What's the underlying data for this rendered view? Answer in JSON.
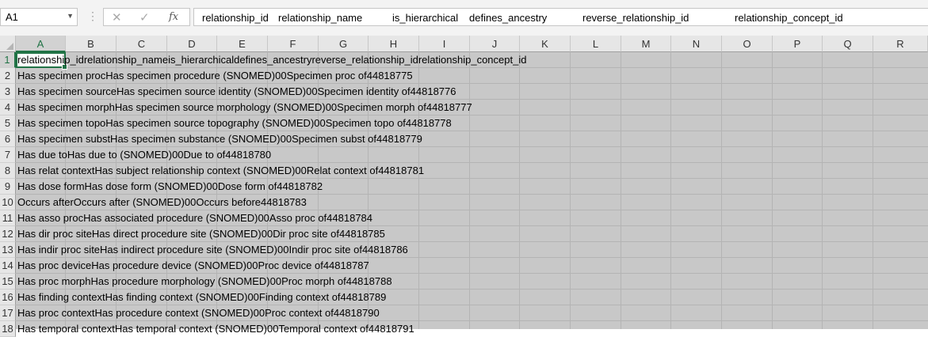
{
  "name_box": {
    "value": "A1",
    "arrow": "▼"
  },
  "formula_bar": {
    "dots": "⋮",
    "cancel_glyph": "✕",
    "enter_glyph": "✓",
    "fx_label": "fx",
    "content": [
      "relationship_id",
      "relationship_name",
      "is_hierarchical",
      "defines_ancestry",
      "reverse_relationship_id",
      "relationship_concept_id"
    ]
  },
  "columns": [
    "A",
    "B",
    "C",
    "D",
    "E",
    "F",
    "G",
    "H",
    "I",
    "J",
    "K",
    "L",
    "M",
    "N",
    "O",
    "P",
    "Q",
    "R"
  ],
  "active_column": "A",
  "active_row": "1",
  "rows": [
    {
      "num": "1",
      "text": "relationship_idrelationship_nameis_hierarchicaldefines_ancestryreverse_relationship_idrelationship_concept_id"
    },
    {
      "num": "2",
      "text": "Has specimen procHas specimen procedure (SNOMED)00Specimen proc of44818775"
    },
    {
      "num": "3",
      "text": "Has specimen sourceHas specimen source identity (SNOMED)00Specimen identity of44818776"
    },
    {
      "num": "4",
      "text": "Has specimen morphHas specimen source morphology (SNOMED)00Specimen morph of44818777"
    },
    {
      "num": "5",
      "text": "Has specimen topoHas specimen source topography (SNOMED)00Specimen topo of44818778"
    },
    {
      "num": "6",
      "text": "Has specimen substHas specimen substance (SNOMED)00Specimen subst of44818779"
    },
    {
      "num": "7",
      "text": "Has due toHas due to (SNOMED)00Due to of44818780"
    },
    {
      "num": "8",
      "text": "Has relat contextHas subject relationship context (SNOMED)00Relat context of44818781"
    },
    {
      "num": "9",
      "text": "Has dose formHas dose form (SNOMED)00Dose form of44818782"
    },
    {
      "num": "10",
      "text": "Occurs afterOccurs after (SNOMED)00Occurs before44818783"
    },
    {
      "num": "11",
      "text": "Has asso procHas associated procedure (SNOMED)00Asso proc of44818784"
    },
    {
      "num": "12",
      "text": "Has dir proc siteHas direct procedure site (SNOMED)00Dir proc site of44818785"
    },
    {
      "num": "13",
      "text": "Has indir proc siteHas indirect procedure site (SNOMED)00Indir proc site of44818786"
    },
    {
      "num": "14",
      "text": "Has proc deviceHas procedure device (SNOMED)00Proc device of44818787"
    },
    {
      "num": "15",
      "text": "Has proc morphHas procedure morphology (SNOMED)00Proc morph of44818788"
    },
    {
      "num": "16",
      "text": "Has finding contextHas finding context (SNOMED)00Finding context of44818789"
    },
    {
      "num": "17",
      "text": "Has proc contextHas procedure context (SNOMED)00Proc context of44818790"
    },
    {
      "num": "18",
      "text": "Has temporal contextHas temporal context (SNOMED)00Temporal context of44818791"
    }
  ],
  "colors": {
    "accent": "#217346",
    "grid_fill": "#c8c8c8",
    "header_bg": "#e6e6e6"
  }
}
